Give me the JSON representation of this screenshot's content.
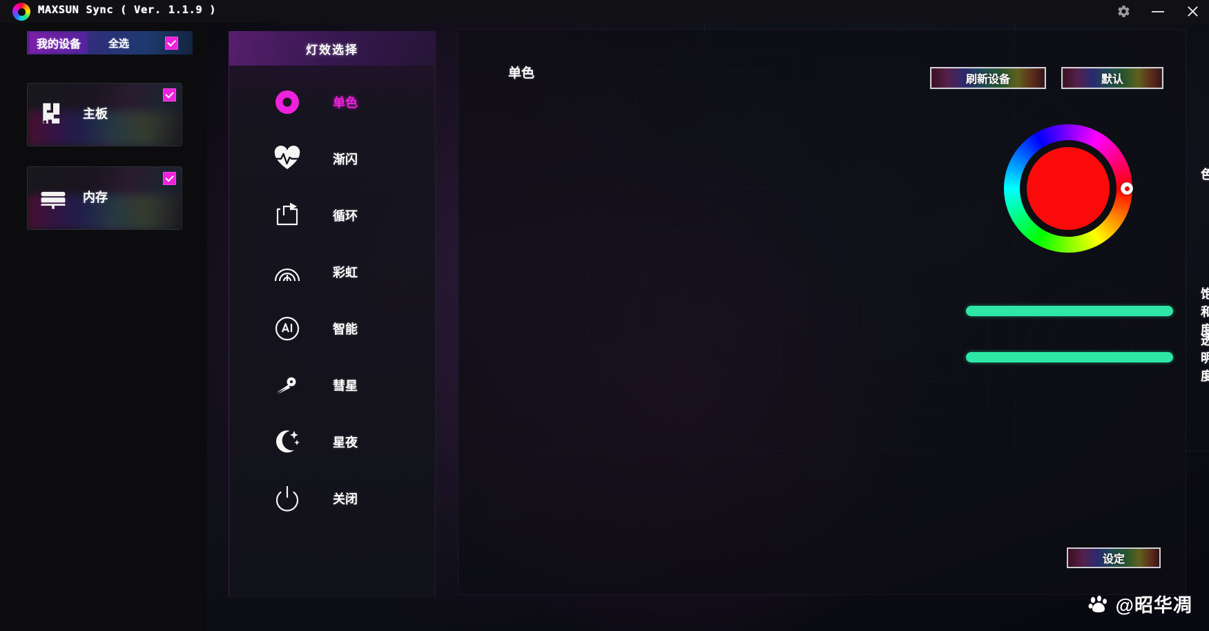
{
  "window": {
    "title": "MAXSUN Sync ( Ver. 1.1.9 )",
    "logo_icon": "maxsun-rgb-ring-logo",
    "controls": {
      "settings_icon": "gear-icon",
      "minimize_icon": "minimize-icon",
      "close_icon": "close-icon"
    }
  },
  "sidebar": {
    "header": {
      "my_devices_label": "我的设备",
      "select_all_label": "全选",
      "select_all_checked": true
    },
    "devices": [
      {
        "label": "主板",
        "icon": "motherboard-icon",
        "checked": true
      },
      {
        "label": "内存",
        "icon": "memory-ram-icon",
        "checked": true
      }
    ]
  },
  "effects_panel": {
    "title": "灯效选择",
    "items": [
      {
        "label": "单色",
        "icon": "solid-color-ring-icon",
        "active": true
      },
      {
        "label": "渐闪",
        "icon": "heartbeat-pulse-icon",
        "active": false
      },
      {
        "label": "循环",
        "icon": "loop-arrow-icon",
        "active": false
      },
      {
        "label": "彩虹",
        "icon": "rainbow-arc-icon",
        "active": false
      },
      {
        "label": "智能",
        "icon": "ai-smart-icon",
        "active": false
      },
      {
        "label": "彗星",
        "icon": "comet-icon",
        "active": false
      },
      {
        "label": "星夜",
        "icon": "moon-stars-icon",
        "active": false
      },
      {
        "label": "关闭",
        "icon": "power-off-icon",
        "active": false
      }
    ]
  },
  "content": {
    "mode_title": "单色",
    "refresh_button": "刷新设备",
    "default_button": "默认",
    "set_button": "设定",
    "color_wheel": {
      "icon": "hue-color-wheel",
      "selected_color": "#FA0A0A",
      "handle_angle_deg": 0
    },
    "hue": {
      "label": "色相",
      "value": "0"
    },
    "saturation": {
      "label": "饱和度",
      "value": "100",
      "percent": 100,
      "fill_color": "#2EE7A6"
    },
    "transparency": {
      "label": "透明度",
      "value": "100",
      "percent": 100,
      "fill_color": "#2EE7A6"
    }
  },
  "watermark": {
    "logo_icon": "baidu-paw-icon",
    "text": "@昭华凋"
  },
  "colors": {
    "accent_magenta": "#EE22DD",
    "slider_green": "#2EE7A6",
    "panel_bg": "#0E0E14",
    "app_bg": "#000000"
  }
}
